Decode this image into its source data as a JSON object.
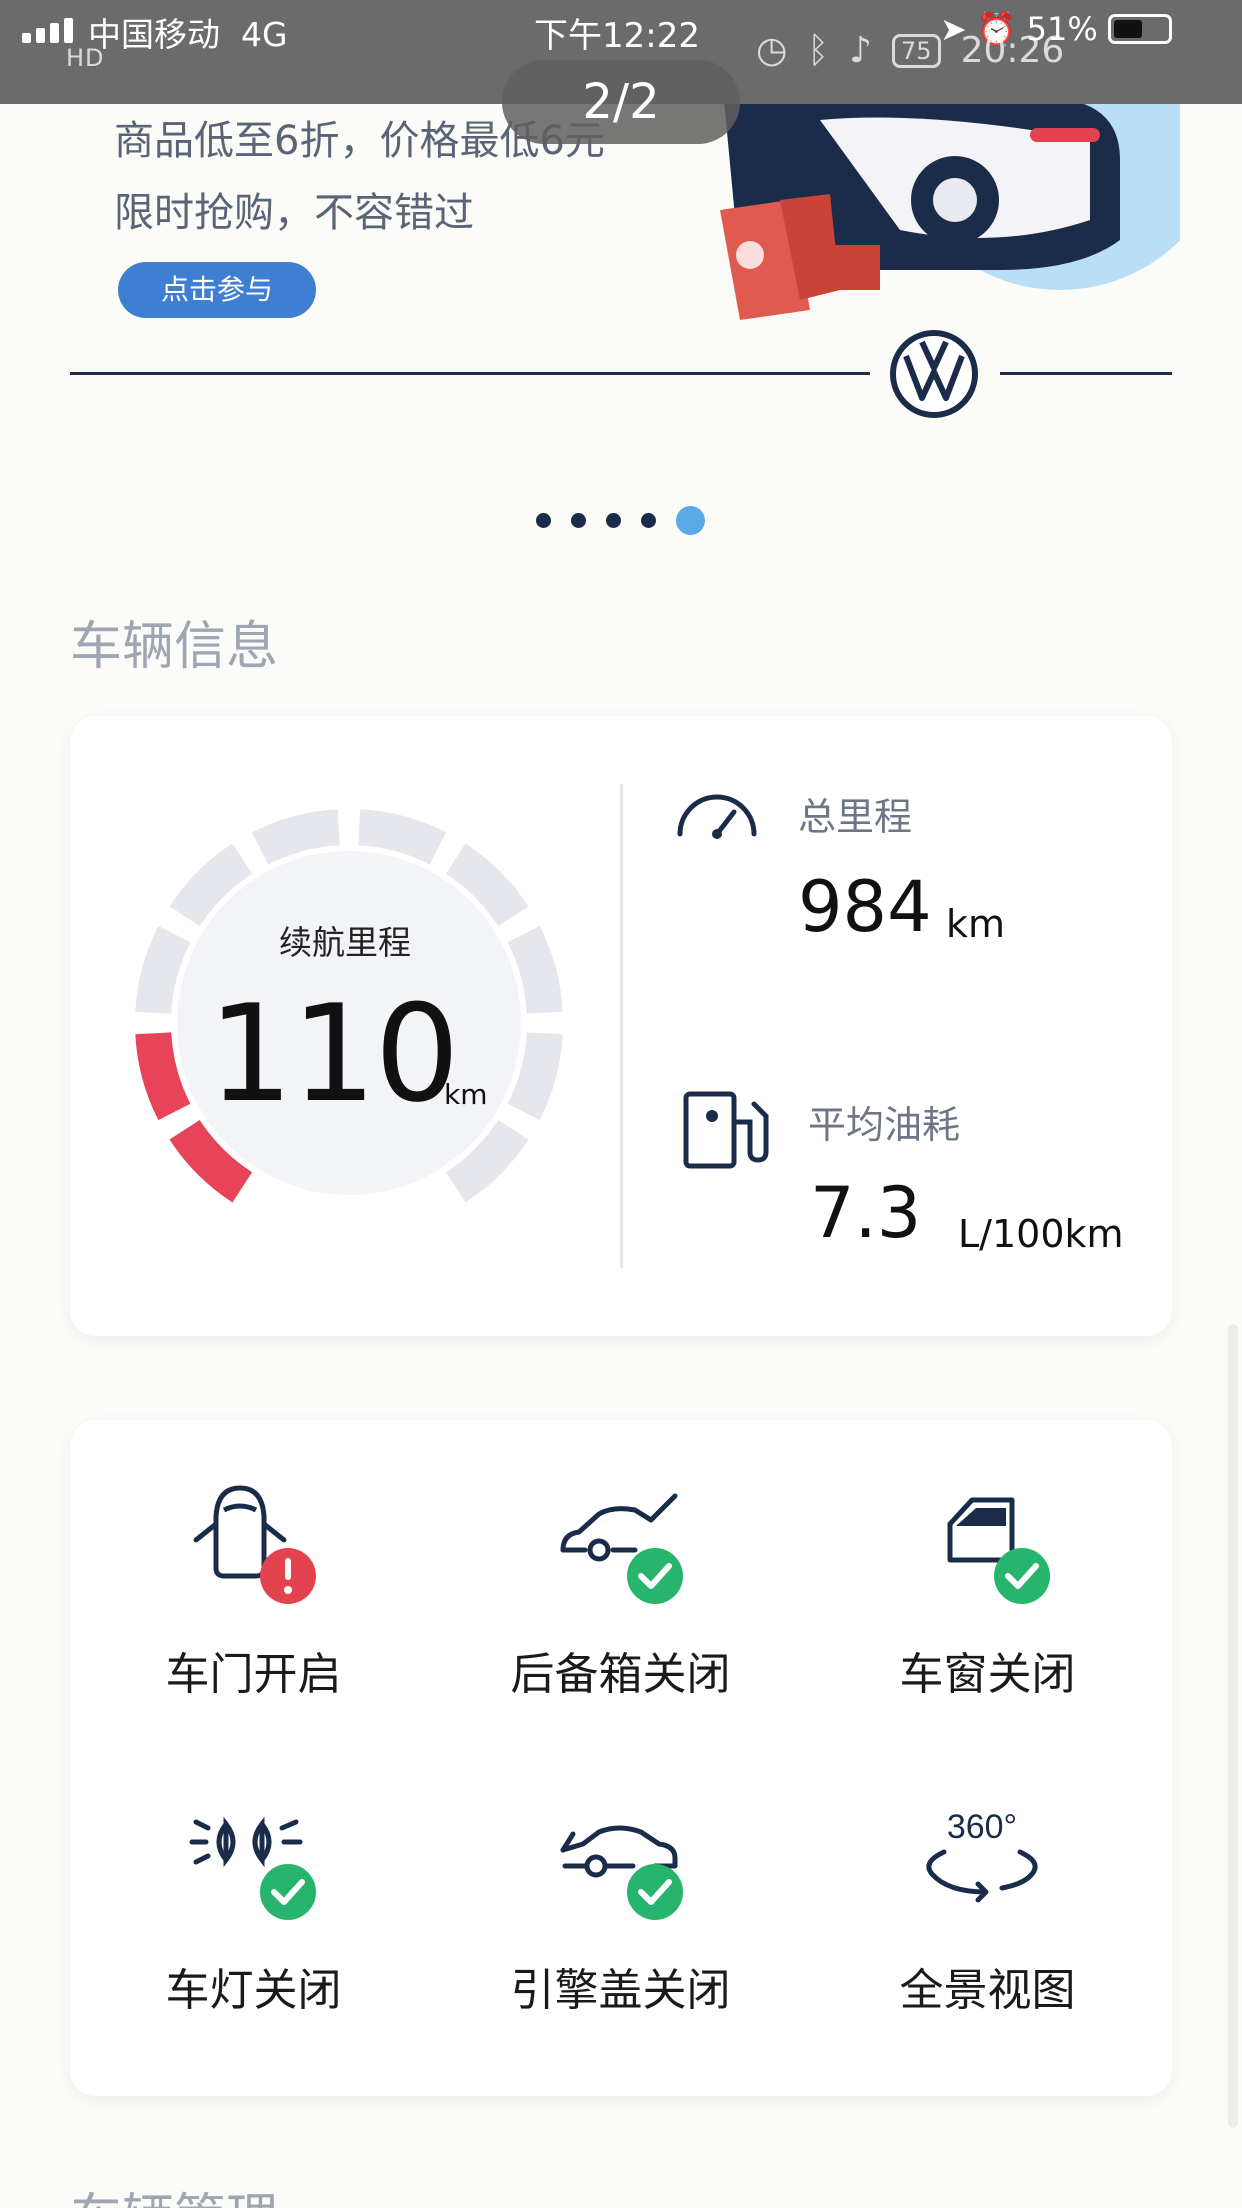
{
  "status_bar": {
    "carrier": "中国移动",
    "network": "4G",
    "time": "下午12:22",
    "battery": "51%",
    "secondary_network": "HD",
    "secondary_badge": "75",
    "secondary_time": "20:26"
  },
  "image_viewer": {
    "page_indicator": "2/2"
  },
  "banner": {
    "line1": "商品低至6折，价格最低6元",
    "line2": "限时抢购，不容错过",
    "cta_label": "点击参与",
    "carousel_pages": 5,
    "carousel_active_index": 4
  },
  "vehicle_info": {
    "section_title": "车辆信息",
    "range": {
      "label": "续航里程",
      "value": "110",
      "unit": "km",
      "gauge_fraction": 0.2
    },
    "odometer": {
      "label": "总里程",
      "value": "984",
      "unit": "km"
    },
    "fuel": {
      "label": "平均油耗",
      "value": "7.3",
      "unit": "L/100km"
    }
  },
  "vehicle_status": [
    {
      "label": "车门开启",
      "icon": "car-door-open-icon",
      "state": "alert"
    },
    {
      "label": "后备箱关闭",
      "icon": "trunk-icon",
      "state": "ok"
    },
    {
      "label": "车窗关闭",
      "icon": "car-window-icon",
      "state": "ok"
    },
    {
      "label": "车灯关闭",
      "icon": "headlight-icon",
      "state": "ok"
    },
    {
      "label": "引擎盖关闭",
      "icon": "hood-icon",
      "state": "ok"
    },
    {
      "label": "全景视图",
      "icon": "panorama-360-icon",
      "state": "none",
      "badge_text": "360°"
    }
  ],
  "next_section_title": "车辆管理",
  "colors": {
    "navy": "#1b2c4b",
    "accent_blue": "#3f7fd1",
    "alert_red": "#e2434f",
    "ok_green": "#27b56d",
    "gauge_red": "#e7445a",
    "gauge_gray": "#e6e7ec"
  }
}
